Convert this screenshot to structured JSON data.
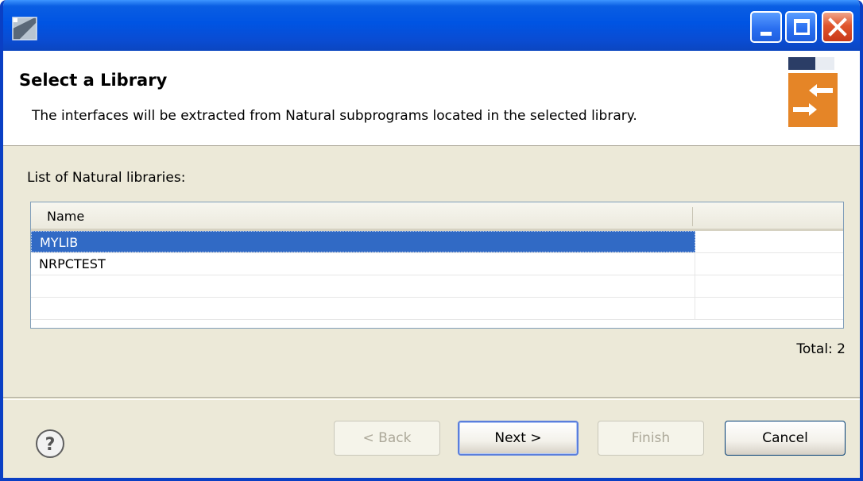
{
  "header": {
    "title": "Select a Library",
    "description": "The interfaces will be extracted from Natural subprograms located in the selected library."
  },
  "list": {
    "label": "List of Natural libraries:",
    "column_header": "Name",
    "rows": [
      "MYLIB",
      "NRPCTEST",
      "",
      ""
    ],
    "selected": "MYLIB",
    "total": "Total: 2"
  },
  "buttons": {
    "back": "< Back",
    "next": "Next >",
    "finish": "Finish",
    "cancel": "Cancel"
  },
  "icons": {
    "app": "eclipse-window-icon",
    "wizard": "extract-arrows-icon",
    "help": "help-icon"
  },
  "colors": {
    "titlebar": "#0054e3",
    "selection": "#316ac5",
    "wizard_accent": "#e58527"
  }
}
